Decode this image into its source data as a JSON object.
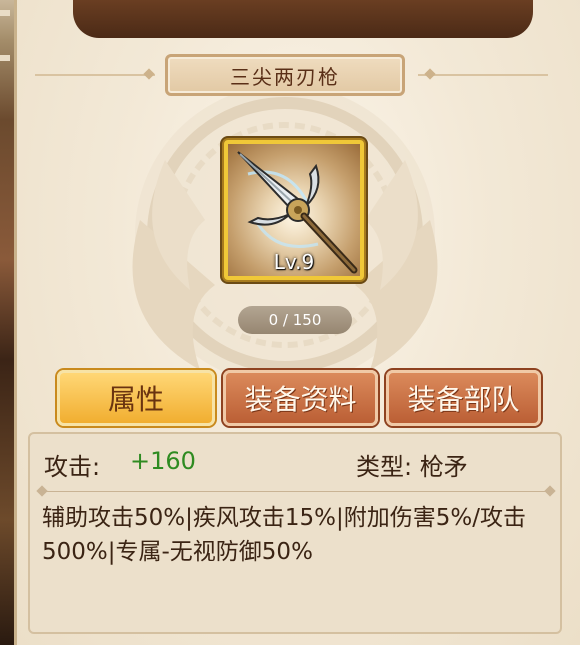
{
  "item": {
    "name": "三尖两刃枪",
    "level": "Lv.9",
    "exp_text": "0 / 150",
    "exp_progress": 0,
    "icon": "trident-spear-icon"
  },
  "tabs": [
    {
      "label": "属性",
      "active": true
    },
    {
      "label": "装备资料",
      "active": false
    },
    {
      "label": "装备部队",
      "active": false
    }
  ],
  "stats": {
    "attack_label": "攻击:",
    "attack_value": "+160",
    "type_label": "类型: 枪矛",
    "description": "辅助攻击50%|疾风攻击15%|附加伤害5%/攻击500%|专属-无视防御50%"
  },
  "colors": {
    "accent_gold": "#f0c838",
    "tab_active": "#f1ae30",
    "tab_normal": "#bb5f35",
    "stat_green": "#2f8b21",
    "title_text": "#5a2f17"
  }
}
